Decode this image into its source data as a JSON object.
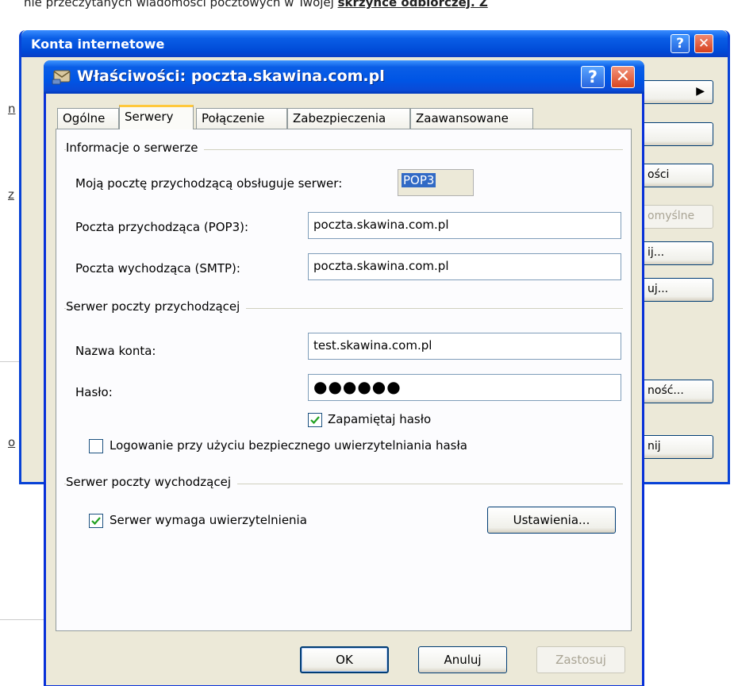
{
  "background_page": {
    "top_text": "nie przeczytanych wiadomości pocztowych w Twojej",
    "top_link": "skrzynce odbiorczej. Z",
    "side_links": [
      "n",
      "z",
      "o"
    ]
  },
  "back_window": {
    "title": "Konta internetowe",
    "help_glyph": "?",
    "close_glyph": "✕",
    "buttons": [
      "▶",
      "",
      "ości",
      "omyślne",
      "ij...",
      "uj...",
      "ność...",
      "nij"
    ]
  },
  "dialog": {
    "title": "Właściwości: poczta.skawina.com.pl",
    "help_glyph": "?",
    "close_glyph": "✕",
    "tabs": [
      "Ogólne",
      "Serwery",
      "Połączenie",
      "Zabezpieczenia",
      "Zaawansowane"
    ],
    "active_tab": "Serwery",
    "server_info": {
      "group_label": "Informacje o serwerze",
      "incoming_type_label": "Moją pocztę przychodzącą obsługuje serwer:",
      "incoming_type_value": "POP3",
      "incoming_label": "Poczta przychodząca (POP3):",
      "incoming_value": "poczta.skawina.com.pl",
      "outgoing_label": "Poczta wychodząca (SMTP):",
      "outgoing_value": "poczta.skawina.com.pl"
    },
    "incoming_server": {
      "group_label": "Serwer poczty przychodzącej",
      "account_label": "Nazwa konta:",
      "account_value": "test.skawina.com.pl",
      "password_label": "Hasło:",
      "password_mask": "●●●●●●",
      "remember_label": "Zapamiętaj hasło",
      "remember_checked": true,
      "spa_label": "Logowanie przy użyciu bezpiecznego uwierzytelniania hasła",
      "spa_checked": false
    },
    "outgoing_server": {
      "group_label": "Serwer poczty wychodzącej",
      "auth_label": "Serwer wymaga uwierzytelnienia",
      "auth_checked": true,
      "settings_button": "Ustawienia..."
    },
    "buttons": {
      "ok": "OK",
      "cancel": "Anuluj",
      "apply": "Zastosuj"
    }
  }
}
